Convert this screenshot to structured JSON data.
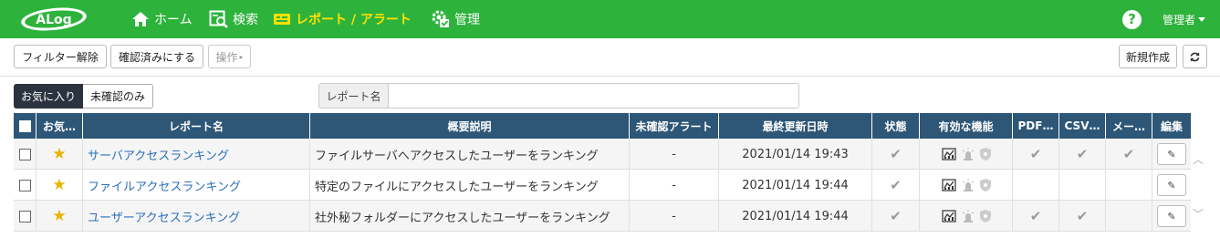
{
  "app": {
    "logo_text": "ALog",
    "nav": [
      {
        "label": "ホーム",
        "icon": "home-icon",
        "active": false
      },
      {
        "label": "検索",
        "icon": "search-icon",
        "active": false
      },
      {
        "label": "レポート / アラート",
        "icon": "report-alert-icon",
        "active": true
      },
      {
        "label": "管理",
        "icon": "manage-gear-icon",
        "active": false
      }
    ],
    "help_label": "?",
    "user_label": "管理者",
    "brand_color": "#2db33c",
    "active_nav_color": "#ffe000"
  },
  "toolbar": {
    "clear_filter_label": "フィルター解除",
    "mark_confirmed_label": "確認済みにする",
    "operations_label": "操作",
    "new_label": "新規作成",
    "refresh_icon": "refresh-icon"
  },
  "filters": {
    "favorites_label": "お気に入り",
    "unconfirmed_label": "未確認のみ",
    "search_label": "レポート名",
    "search_value": ""
  },
  "table": {
    "headers": {
      "favorite": "お気…",
      "name": "レポート名",
      "summary": "概要説明",
      "unconfirmed": "未確認アラート",
      "updated": "最終更新日時",
      "status": "状態",
      "features": "有効な機能",
      "pdf": "PDF…",
      "csv": "CSV…",
      "mail": "メー…",
      "edit": "編集"
    },
    "header_color": "#2d5677",
    "rows": [
      {
        "name": "サーバアクセスランキング",
        "summary": "ファイルサーバへアクセスしたユーザーをランキング",
        "unconfirmed": "-",
        "updated": "2021/01/14 19:43",
        "status": "✔",
        "pdf": "✔",
        "csv": "✔",
        "mail": "✔"
      },
      {
        "name": "ファイルアクセスランキング",
        "summary": "特定のファイルにアクセスしたユーザーをランキング",
        "unconfirmed": "-",
        "updated": "2021/01/14 19:44",
        "status": "✔",
        "pdf": "",
        "csv": "",
        "mail": ""
      },
      {
        "name": "ユーザーアクセスランキング",
        "summary": "社外秘フォルダーにアクセスしたユーザーをランキング",
        "unconfirmed": "-",
        "updated": "2021/01/14 19:44",
        "status": "✔",
        "pdf": "✔",
        "csv": "✔",
        "mail": ""
      }
    ]
  }
}
